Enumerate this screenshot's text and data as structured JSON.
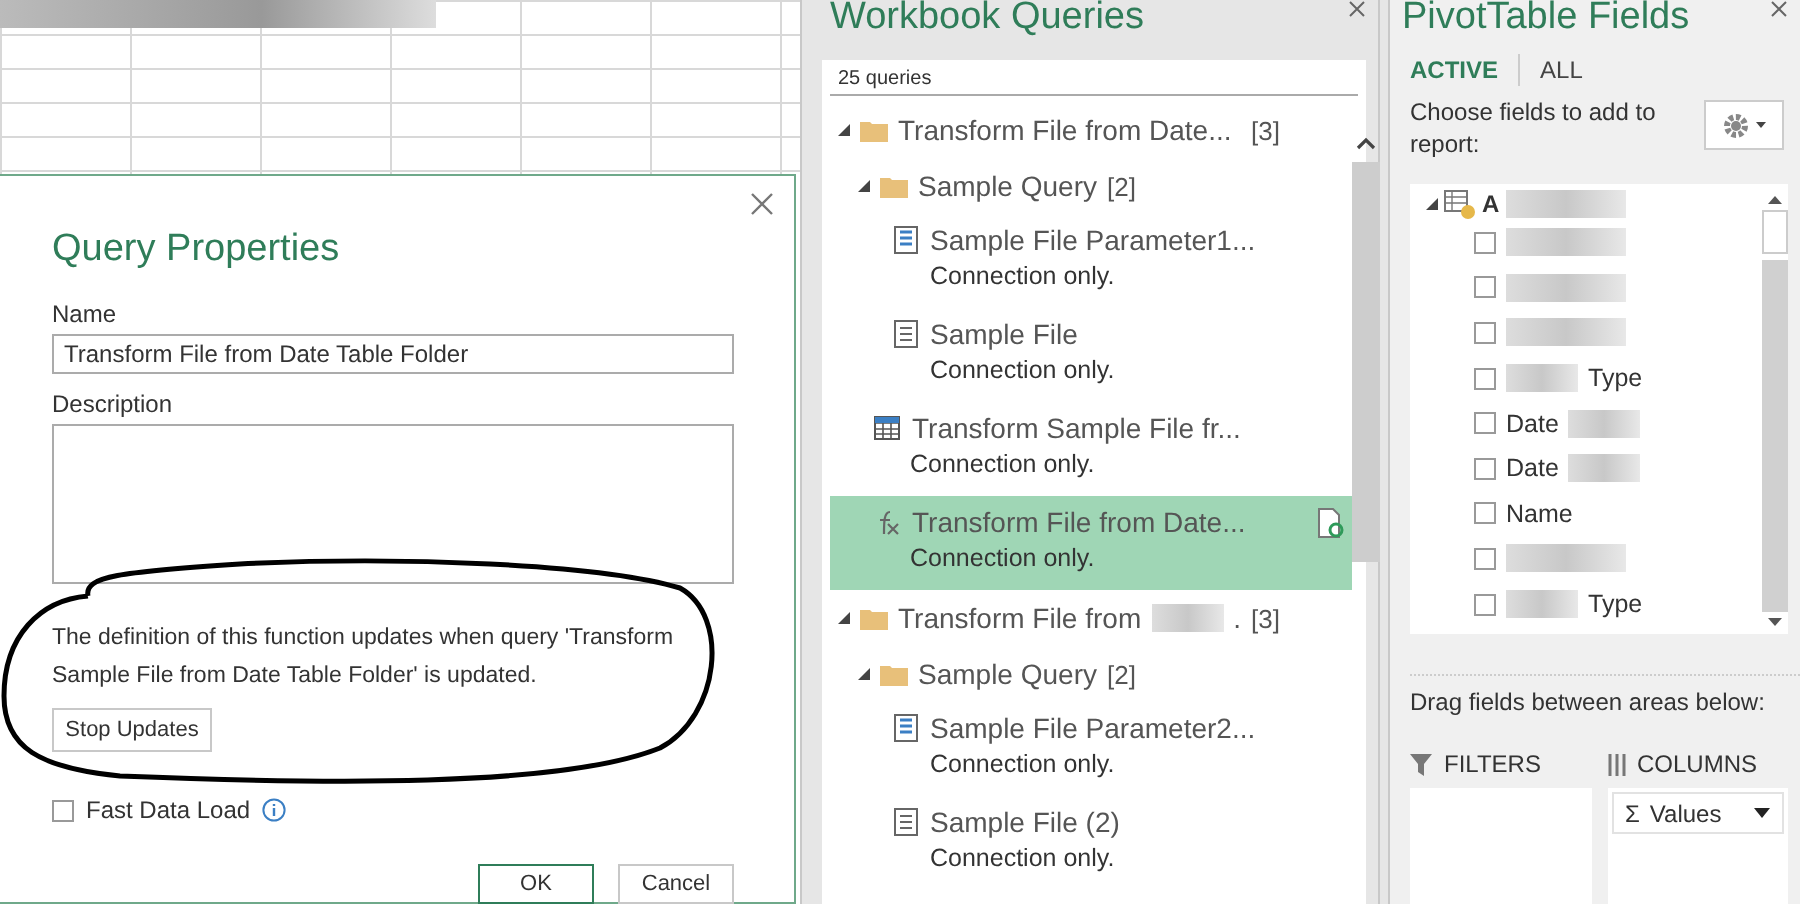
{
  "dialog": {
    "title": "Query Properties",
    "name_label": "Name",
    "name_value": "Transform File from Date Table Folder",
    "description_label": "Description",
    "note": "The definition of this function updates when query 'Transform Sample File from Date Table Folder' is updated.",
    "stop_button": "Stop Updates",
    "fast_load": {
      "label": "Fast Data Load",
      "checked": false
    },
    "buttons": [
      "OK",
      "Cancel"
    ]
  },
  "queries_pane": {
    "title": "Workbook Queries",
    "count": "25 queries",
    "tree": [
      {
        "kind": "group",
        "label": "Transform File from Date...",
        "count": "[3]",
        "expanded": true,
        "children": [
          {
            "kind": "group",
            "label": "Sample Query",
            "count": "[2]",
            "expanded": true,
            "children": [
              {
                "kind": "parameter",
                "label": "Sample File Parameter1...",
                "status": "Connection only.",
                "selected": false
              },
              {
                "kind": "file",
                "label": "Sample File",
                "status": "Connection only.",
                "selected": false
              }
            ]
          },
          {
            "kind": "table",
            "label": "Transform Sample File fr...",
            "status": "Connection only.",
            "selected": false
          },
          {
            "kind": "function",
            "label": "Transform File from Date...",
            "status": "Connection only.",
            "selected": true
          }
        ]
      },
      {
        "kind": "group",
        "label": "Transform File from",
        "tail": ".",
        "count": "[3]",
        "expanded": true,
        "children": [
          {
            "kind": "group",
            "label": "Sample Query",
            "count": "[2]",
            "expanded": true,
            "children": [
              {
                "kind": "parameter",
                "label": "Sample File Parameter2...",
                "status": "Connection only.",
                "selected": false
              },
              {
                "kind": "file",
                "label": "Sample File (2)",
                "status": "Connection only.",
                "selected": false
              }
            ]
          }
        ]
      }
    ]
  },
  "pivot_pane": {
    "title": "PivotTable Fields",
    "tabs": [
      {
        "label": "ACTIVE",
        "selected": true
      },
      {
        "label": "ALL",
        "selected": false
      }
    ],
    "choose_text": "Choose fields to add to report:",
    "table": {
      "label": "A",
      "blur_after": true,
      "expanded": true
    },
    "fields": [
      {
        "blur_before": true,
        "checked": false
      },
      {
        "blur_before": true,
        "checked": false
      },
      {
        "blur_before": true,
        "checked": false
      },
      {
        "text": "Type",
        "blur_before": true,
        "checked": false
      },
      {
        "text": "Date",
        "blur_after": true,
        "checked": false
      },
      {
        "text": "Date",
        "blur_after": true,
        "checked": false
      },
      {
        "text": "Name",
        "checked": false
      },
      {
        "blur_before": true,
        "checked": false
      },
      {
        "text": "Type",
        "blur_before": true,
        "checked": false
      }
    ],
    "drag_text": "Drag fields between areas below:",
    "areas": [
      {
        "kind": "filters",
        "label": "FILTERS"
      },
      {
        "kind": "columns",
        "label": "COLUMNS",
        "chips": [
          {
            "symbol": "Σ",
            "label": "Values"
          }
        ]
      }
    ]
  }
}
